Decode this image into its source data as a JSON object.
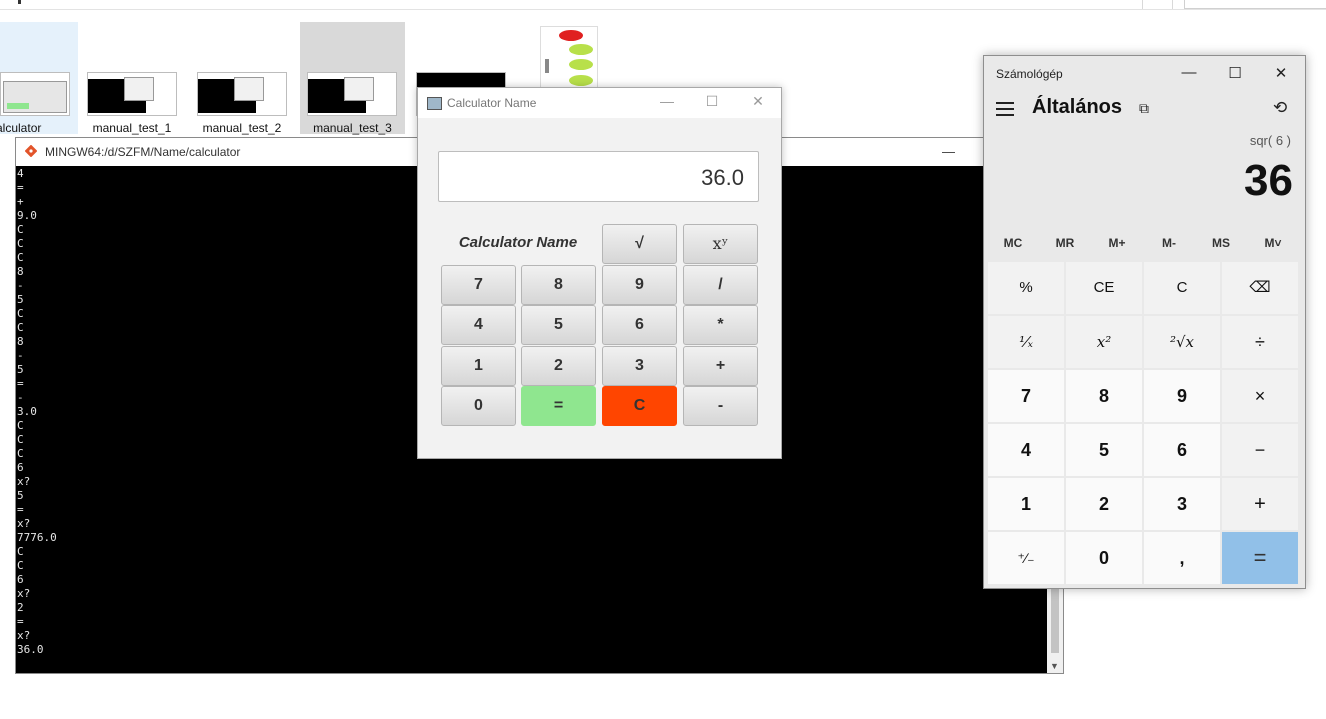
{
  "explorer": {
    "thumbnails": [
      {
        "label": "calculator"
      },
      {
        "label": "manual_test_1"
      },
      {
        "label": "manual_test_2"
      },
      {
        "label": "manual_test_3"
      },
      {
        "label": ""
      },
      {
        "label": ""
      }
    ]
  },
  "terminal": {
    "title": "MINGW64:/d/SZFM/Name/calculator",
    "minimize": "—",
    "lines": [
      "4",
      "=",
      "+",
      "9.0",
      "C",
      "C",
      "C",
      "8",
      "-",
      "5",
      "C",
      "C",
      "8",
      "-",
      "5",
      "=",
      "-",
      "3.0",
      "C",
      "C",
      "C",
      "6",
      "x?",
      "5",
      "=",
      "x?",
      "7776.0",
      "C",
      "C",
      "6",
      "x?",
      "2",
      "=",
      "x?",
      "36.0"
    ]
  },
  "fx_calculator": {
    "title": "Calculator Name",
    "controls": {
      "minimize": "—",
      "maximize": "☐",
      "close": "✕"
    },
    "display": "36.0",
    "name_label": "Calculator Name",
    "keys": [
      "√",
      "xʸ",
      "7",
      "8",
      "9",
      "/",
      "4",
      "5",
      "6",
      "*",
      "1",
      "2",
      "3",
      "+",
      "0",
      "=",
      "C",
      "-"
    ],
    "colors": {
      "equals": "#8fe68f",
      "clear": "#ff4500"
    }
  },
  "win_calculator": {
    "title": "Számológép",
    "controls": {
      "minimize": "—",
      "maximize": "☐",
      "close": "✕"
    },
    "mode": "Általános",
    "keep_on_top_icon": "keep-on-top-icon",
    "history_icon": "history-icon",
    "expression": "sqr( 6 )",
    "result": "36",
    "memory": [
      "MC",
      "MR",
      "M+",
      "M-",
      "MS",
      "M˅"
    ],
    "keys": [
      "%",
      "CE",
      "C",
      "⌫",
      "¹⁄ₓ",
      "x²",
      "²√x",
      "÷",
      "7",
      "8",
      "9",
      "×",
      "4",
      "5",
      "6",
      "−",
      "1",
      "2",
      "3",
      "+",
      "⁺∕₋",
      "0",
      ",",
      "="
    ],
    "colors": {
      "equals": "#91c0e8"
    }
  }
}
